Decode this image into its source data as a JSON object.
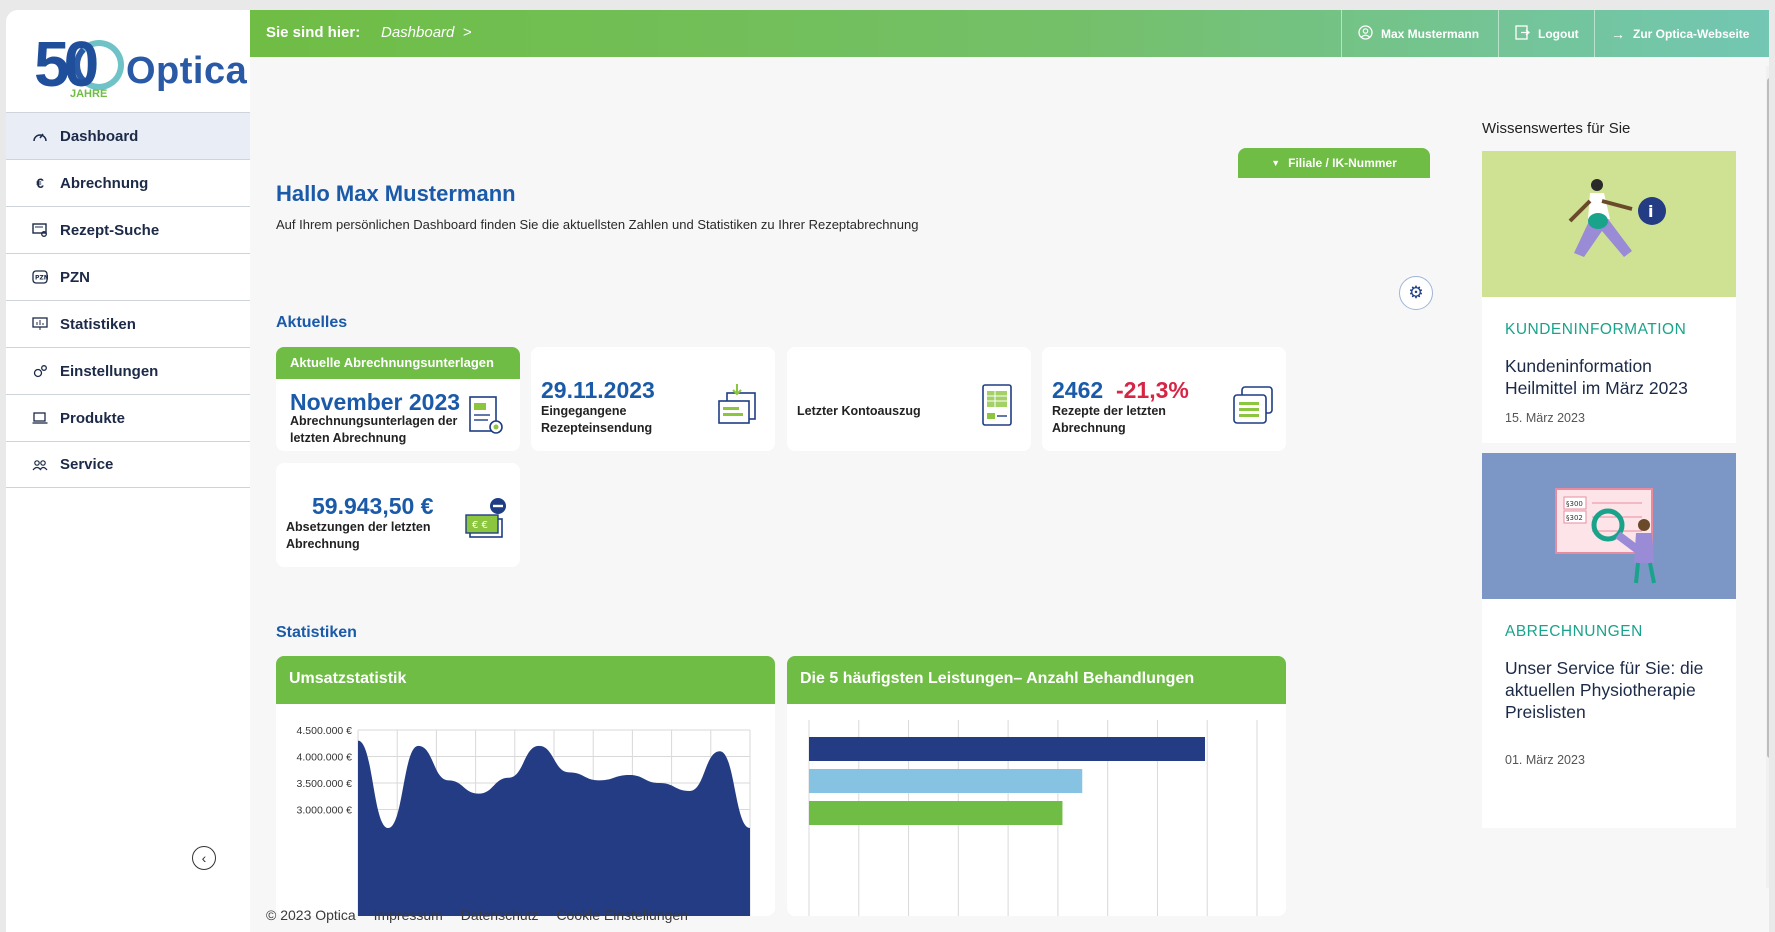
{
  "logo": {
    "number": "50",
    "jahre": "JAHRE",
    "brand": "Optica"
  },
  "sidebar": {
    "items": [
      {
        "label": "Dashboard"
      },
      {
        "label": "Abrechnung"
      },
      {
        "label": "Rezept-Suche"
      },
      {
        "label": "PZN"
      },
      {
        "label": "Statistiken"
      },
      {
        "label": "Einstellungen"
      },
      {
        "label": "Produkte"
      },
      {
        "label": "Service"
      }
    ]
  },
  "topbar": {
    "crumb_label": "Sie sind hier:",
    "crumb_value": "Dashboard",
    "crumb_sep": ">",
    "user": "Max Mustermann",
    "logout": "Logout",
    "website": "Zur Optica-Webseite"
  },
  "main": {
    "filiale": "Filiale / IK-Nummer",
    "greeting": "Hallo Max Mustermann",
    "intro": "Auf Ihrem persönlichen Dashboard finden Sie die aktuellsten Zahlen und Statistiken zu Ihrer Rezeptabrechnung",
    "aktuelles_heading": "Aktuelles",
    "statistiken_heading": "Statistiken"
  },
  "cards": {
    "c1": {
      "tag": "Aktuelle Abrechnungsunterlagen",
      "value": "November 2023",
      "label1": "Abrechnungsunterlagen der",
      "label2": "letzten Abrechnung"
    },
    "c2": {
      "value": "29.11.2023",
      "label1": "Eingegangene",
      "label2": "Rezepteinsendung"
    },
    "c3": {
      "label": "Letzter Kontoauszug"
    },
    "c4": {
      "value": "2462",
      "change": "-21,3%",
      "label1": "Rezepte der letzten",
      "label2": "Abrechnung"
    },
    "c5": {
      "value": "59.943,50 €",
      "label1": "Absetzungen der letzten",
      "label2": "Abrechnung"
    }
  },
  "charts": {
    "umsatz_title": "Umsatzstatistik",
    "leistungen_title": "Die 5 häufigsten Leistungen– Anzahl Behandlungen"
  },
  "chart_data": [
    {
      "type": "area",
      "title": "Umsatzstatistik",
      "y_ticks": [
        "4.500.000 €",
        "4.000.000 €",
        "3.500.000 €",
        "3.000.000 €"
      ],
      "ylim": [
        2700000,
        4500000
      ],
      "series": [
        {
          "values": [
            4300000,
            2650000,
            4200000,
            3550000,
            3300000,
            3600000,
            4200000,
            3700000,
            3550000,
            3650000,
            3500000,
            3350000,
            4100000,
            2650000
          ]
        }
      ],
      "color": "#233c84"
    },
    {
      "type": "bar",
      "title": "Die 5 häufigsten Leistungen– Anzahl Behandlungen",
      "orientation": "horizontal",
      "values": [
        1.0,
        0.69,
        0.64
      ],
      "colors": [
        "#233c84",
        "#86c3e3",
        "#6fbd44"
      ]
    }
  ],
  "sidebar_panel": {
    "heading": "Wissenswertes für Sie",
    "news": [
      {
        "category": "KUNDENINFORMATION",
        "title": "Kundeninformation Heilmittel im März 2023",
        "date": "15. März 2023"
      },
      {
        "category": "ABRECHNUNGEN",
        "title": "Unser Service für Sie: die aktuellen Physiotherapie Preislisten",
        "date": "01. März 2023",
        "img_labels": [
          "§300",
          "§302"
        ]
      }
    ]
  },
  "footer": {
    "copyright": "© 2023 Optica",
    "impressum": "Impressum",
    "datenschutz": "Datenschutz",
    "cookies": "Cookie Einstellungen"
  }
}
